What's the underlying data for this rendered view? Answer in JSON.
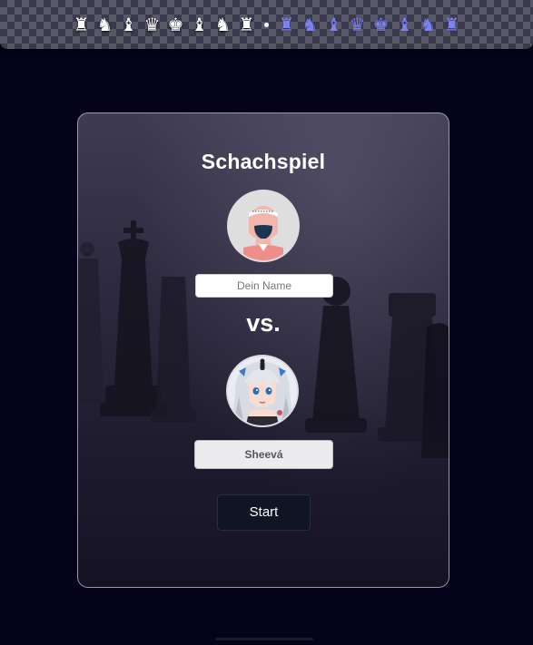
{
  "banner": {
    "white_pieces": [
      "♜",
      "♞",
      "♝",
      "♛",
      "♚",
      "♝",
      "♞",
      "♜"
    ],
    "black_pieces": [
      "♜",
      "♞",
      "♝",
      "♛",
      "♚",
      "♝",
      "♞",
      "♜"
    ],
    "white_color": "#ffffff",
    "blue_color": "#7c82ee"
  },
  "card": {
    "title": "Schachspiel",
    "player_name_placeholder": "Dein Name",
    "player_name_value": "",
    "vs_label": "vs.",
    "opponent_name": "Sheevá",
    "start_label": "Start"
  },
  "colors": {
    "background": "#05031a",
    "start_button": "#0f1522",
    "accent_blue": "#7c82ee"
  }
}
